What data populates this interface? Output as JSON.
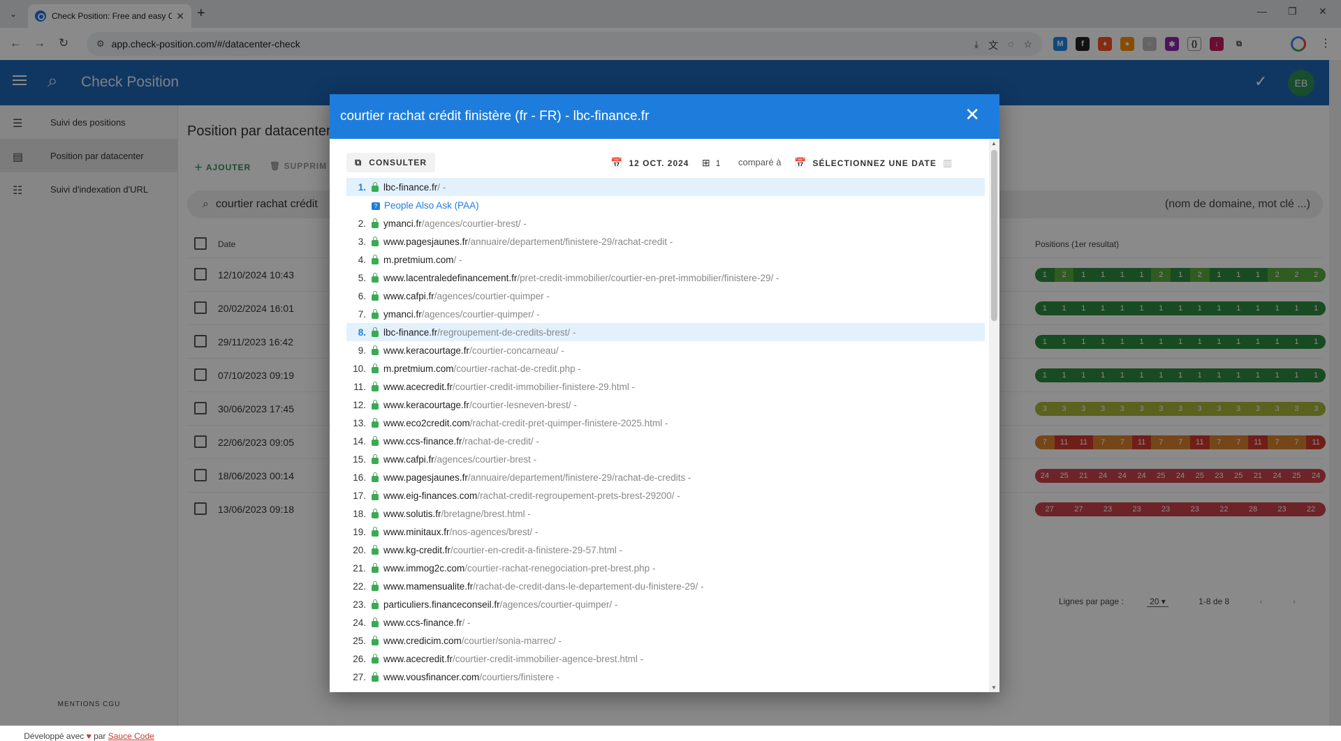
{
  "browser": {
    "tab_title": "Check Position: Free and easy C",
    "url": "app.check-position.com/#/datacenter-check"
  },
  "app": {
    "brand": "Check Position",
    "avatar": "EB",
    "nav": [
      {
        "label": "Suivi des positions",
        "icon": "list-icon"
      },
      {
        "label": "Position par datacenter",
        "icon": "server-icon",
        "active": true
      },
      {
        "label": "Suivi d'indexation d'URL",
        "icon": "checklist-icon"
      }
    ],
    "footer_links": "MENTIONS   CGU",
    "footer_text": "Développé avec",
    "footer_by": "par",
    "footer_link": "Sauce Code"
  },
  "main": {
    "title": "Position par datacenter",
    "add_label": "AJOUTER",
    "delete_label": "SUPPRIM",
    "search_value": "courtier rachat crédit",
    "search_hint": "(nom de domaine, mot clé ...)",
    "col_date": "Date",
    "col_positions": "Positions (1er resultat)",
    "rows": [
      {
        "date": "12/10/2024 10:43",
        "pos": [
          "1",
          "2",
          "1",
          "1",
          "1",
          "1",
          "2",
          "1",
          "2",
          "1",
          "1",
          "1",
          "2",
          "2",
          "2"
        ]
      },
      {
        "date": "20/02/2024 16:01",
        "pos": [
          "1",
          "1",
          "1",
          "1",
          "1",
          "1",
          "1",
          "1",
          "1",
          "1",
          "1",
          "1",
          "1",
          "1",
          "1"
        ]
      },
      {
        "date": "29/11/2023 16:42",
        "pos": [
          "1",
          "1",
          "1",
          "1",
          "1",
          "1",
          "1",
          "1",
          "1",
          "1",
          "1",
          "1",
          "1",
          "1",
          "1"
        ]
      },
      {
        "date": "07/10/2023 09:19",
        "pos": [
          "1",
          "1",
          "1",
          "1",
          "1",
          "1",
          "1",
          "1",
          "1",
          "1",
          "1",
          "1",
          "1",
          "1",
          "1"
        ]
      },
      {
        "date": "30/06/2023 17:45",
        "pos": [
          "3",
          "3",
          "3",
          "3",
          "3",
          "3",
          "3",
          "3",
          "3",
          "3",
          "3",
          "3",
          "3",
          "3",
          "3"
        ]
      },
      {
        "date": "22/06/2023 09:05",
        "pos": [
          "7",
          "11",
          "11",
          "7",
          "7",
          "11",
          "7",
          "7",
          "11",
          "7",
          "7",
          "11",
          "7",
          "7",
          "11"
        ]
      },
      {
        "date": "18/06/2023 00:14",
        "pos": [
          "24",
          "25",
          "21",
          "24",
          "24",
          "24",
          "25",
          "24",
          "25",
          "23",
          "25",
          "21",
          "24",
          "25",
          "24"
        ]
      },
      {
        "date": "13/06/2023 09:18",
        "pos": [
          "27",
          "27",
          "23",
          "23",
          "23",
          "23",
          "22",
          "28",
          "23",
          "22"
        ]
      }
    ],
    "pager_label": "Lignes par page :",
    "pager_size": "20",
    "pager_range": "1-8 de 8"
  },
  "modal": {
    "title": "courtier rachat crédit finistère (fr - FR) - lbc-finance.fr",
    "consult_label": "CONSULTER",
    "date": "12 OCT. 2024",
    "datacenter": "1",
    "compare_label": "comparé à",
    "select_date_label": "SÉLECTIONNEZ UNE DATE",
    "paa_label": "People Also Ask (PAA)",
    "results": [
      {
        "n": "1.",
        "domain": "lbc-finance.fr",
        "path": "/ -",
        "hl": true
      },
      {
        "n": "2.",
        "domain": "ymanci.fr",
        "path": "/agences/courtier-brest/ -"
      },
      {
        "n": "3.",
        "domain": "www.pagesjaunes.fr",
        "path": "/annuaire/departement/finistere-29/rachat-credit -"
      },
      {
        "n": "4.",
        "domain": "m.pretmium.com",
        "path": "/ -"
      },
      {
        "n": "5.",
        "domain": "www.lacentraledefinancement.fr",
        "path": "/pret-credit-immobilier/courtier-en-pret-immobilier/finistere-29/ -"
      },
      {
        "n": "6.",
        "domain": "www.cafpi.fr",
        "path": "/agences/courtier-quimper -"
      },
      {
        "n": "7.",
        "domain": "ymanci.fr",
        "path": "/agences/courtier-quimper/ -"
      },
      {
        "n": "8.",
        "domain": "lbc-finance.fr",
        "path": "/regroupement-de-credits-brest/ -",
        "hl": true
      },
      {
        "n": "9.",
        "domain": "www.keracourtage.fr",
        "path": "/courtier-concarneau/ -"
      },
      {
        "n": "10.",
        "domain": "m.pretmium.com",
        "path": "/courtier-rachat-de-credit.php -"
      },
      {
        "n": "11.",
        "domain": "www.acecredit.fr",
        "path": "/courtier-credit-immobilier-finistere-29.html -"
      },
      {
        "n": "12.",
        "domain": "www.keracourtage.fr",
        "path": "/courtier-lesneven-brest/ -"
      },
      {
        "n": "13.",
        "domain": "www.eco2credit.com",
        "path": "/rachat-credit-pret-quimper-finistere-2025.html -"
      },
      {
        "n": "14.",
        "domain": "www.ccs-finance.fr",
        "path": "/rachat-de-credit/ -"
      },
      {
        "n": "15.",
        "domain": "www.cafpi.fr",
        "path": "/agences/courtier-brest -"
      },
      {
        "n": "16.",
        "domain": "www.pagesjaunes.fr",
        "path": "/annuaire/departement/finistere-29/rachat-de-credits -"
      },
      {
        "n": "17.",
        "domain": "www.eig-finances.com",
        "path": "/rachat-credit-regroupement-prets-brest-29200/ -"
      },
      {
        "n": "18.",
        "domain": "www.solutis.fr",
        "path": "/bretagne/brest.html -"
      },
      {
        "n": "19.",
        "domain": "www.minitaux.fr",
        "path": "/nos-agences/brest/ -"
      },
      {
        "n": "20.",
        "domain": "www.kg-credit.fr",
        "path": "/courtier-en-credit-a-finistere-29-57.html -"
      },
      {
        "n": "21.",
        "domain": "www.immog2c.com",
        "path": "/courtier-rachat-renegociation-pret-brest.php -"
      },
      {
        "n": "22.",
        "domain": "www.mamensualite.fr",
        "path": "/rachat-de-credit-dans-le-departement-du-finistere-29/ -"
      },
      {
        "n": "23.",
        "domain": "particuliers.financeconseil.fr",
        "path": "/agences/courtier-quimper/ -"
      },
      {
        "n": "24.",
        "domain": "www.ccs-finance.fr",
        "path": "/ -"
      },
      {
        "n": "25.",
        "domain": "www.credicim.com",
        "path": "/courtier/sonia-marrec/ -"
      },
      {
        "n": "26.",
        "domain": "www.acecredit.fr",
        "path": "/courtier-credit-immobilier-agence-brest.html -"
      },
      {
        "n": "27.",
        "domain": "www.vousfinancer.com",
        "path": "/courtiers/finistere -"
      }
    ]
  },
  "colors": {
    "appbar": "#1e67b5",
    "modal_header": "#1e7ddc",
    "pos_1": "#2e8b3e",
    "pos_2": "#5aa83e",
    "pos_3": "#a7b53a",
    "pos_7": "#d9822b",
    "pos_11": "#cf3a2e",
    "pos_20plus": "#c9444a"
  }
}
